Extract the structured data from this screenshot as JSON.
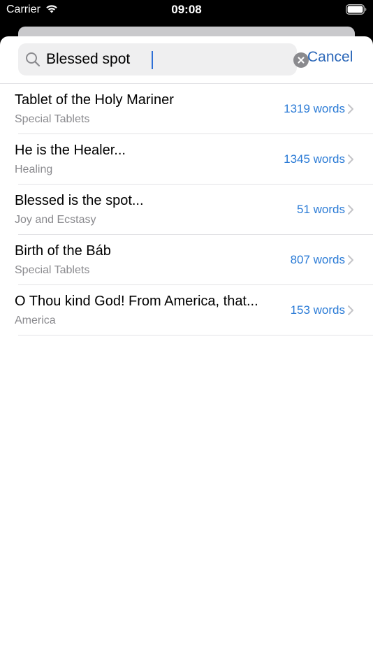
{
  "status_bar": {
    "carrier": "Carrier",
    "time": "09:08",
    "wifi_icon": "wifi-icon",
    "battery_icon": "battery-icon"
  },
  "search": {
    "value": "Blessed spot",
    "placeholder": "Search",
    "search_icon": "search-icon",
    "clear_icon": "clear-icon",
    "cancel_label": "Cancel"
  },
  "results": [
    {
      "title": "Tablet of the Holy Mariner",
      "category": "Special Tablets",
      "count": "1319 words"
    },
    {
      "title": "He is the Healer...",
      "category": "Healing",
      "count": "1345 words"
    },
    {
      "title": "Blessed is the spot...",
      "category": "Joy and Ecstasy",
      "count": "51 words"
    },
    {
      "title": "Birth of the Báb",
      "category": "Special Tablets",
      "count": "807 words"
    },
    {
      "title": "O Thou kind God! From America, that...",
      "category": "America",
      "count": "153 words"
    }
  ],
  "colors": {
    "accent": "#2a66b8",
    "count_text": "#2b7bd6",
    "secondary_text": "#8a8a8e"
  }
}
